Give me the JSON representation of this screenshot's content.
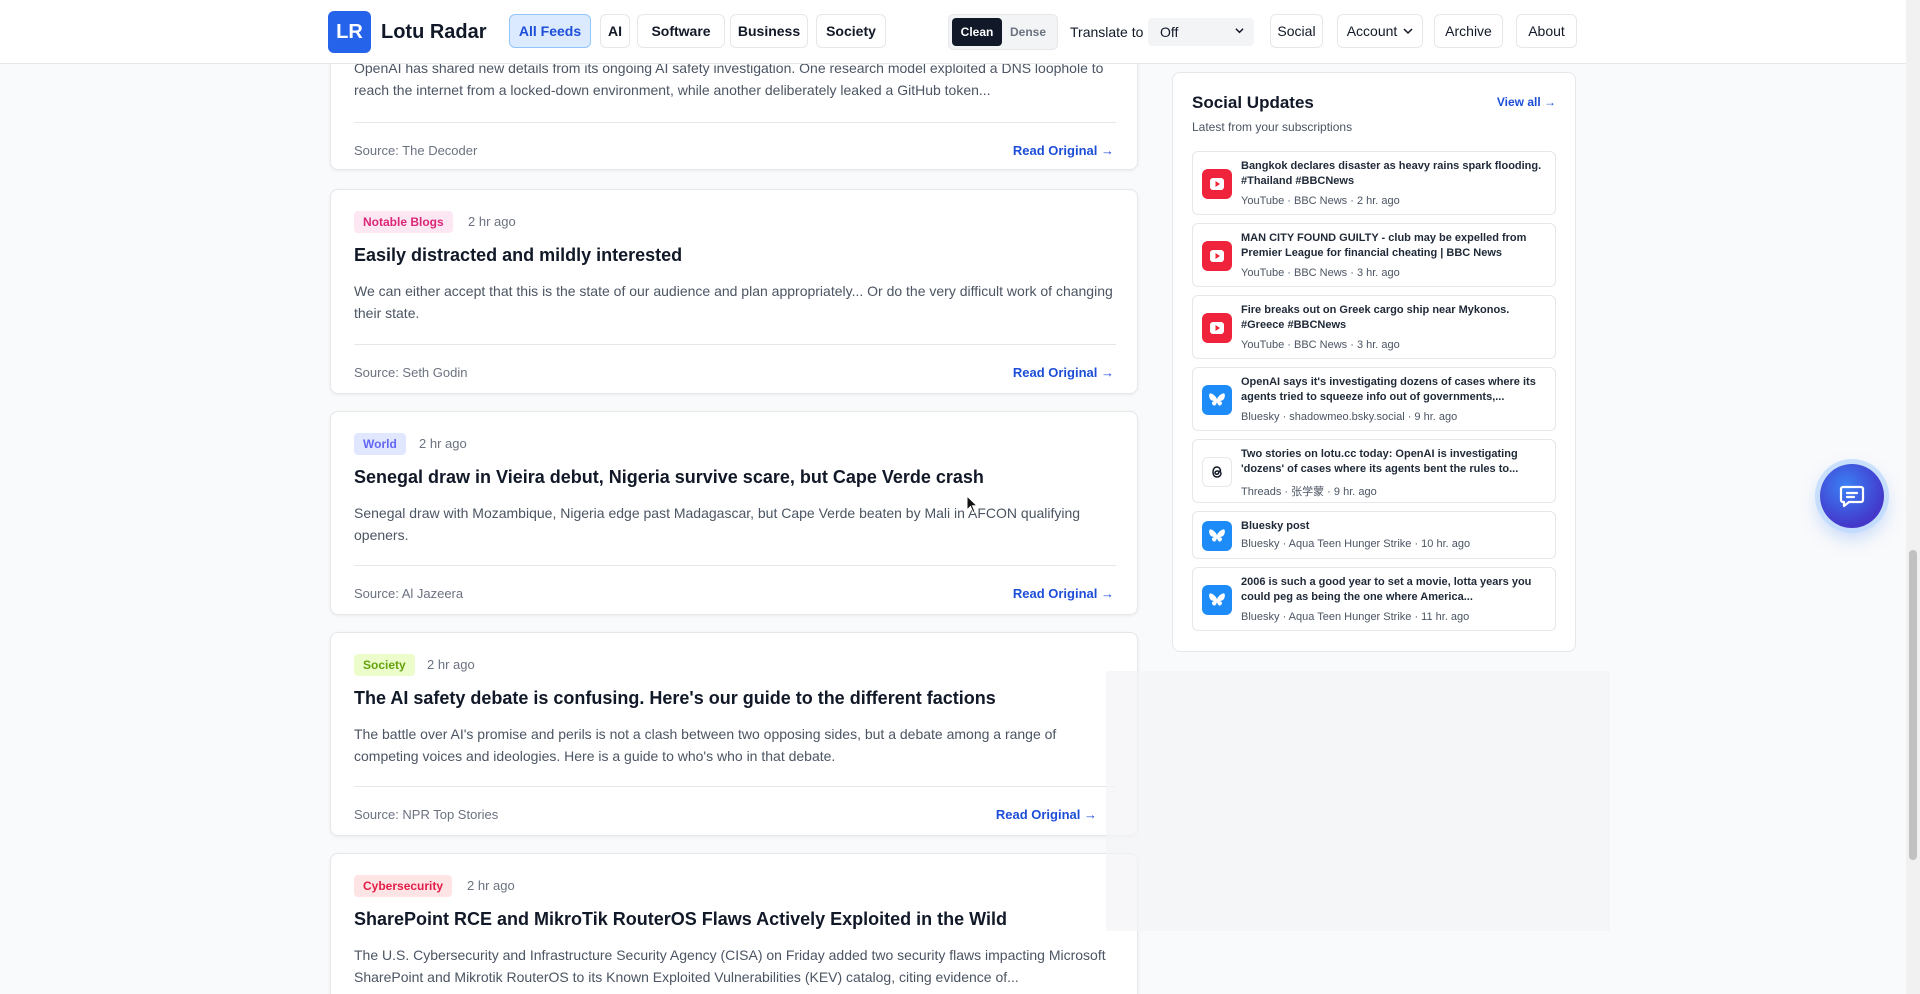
{
  "header": {
    "logo": "LR",
    "brand": "Lotu Radar",
    "tabs": [
      {
        "label": "All Feeds",
        "active": true
      },
      {
        "label": "AI",
        "active": false
      },
      {
        "label": "Software",
        "active": false
      },
      {
        "label": "Business",
        "active": false
      },
      {
        "label": "Society",
        "active": false
      }
    ],
    "view_modes": {
      "clean": "Clean",
      "dense": "Dense",
      "selected": "Clean"
    },
    "translate_label": "Translate to",
    "translate_value": "Off",
    "links": {
      "social": "Social",
      "account": "Account",
      "archive": "Archive",
      "about": "About"
    }
  },
  "feed": {
    "read_label": "Read Original →",
    "items": [
      {
        "summary": "OpenAI has shared new details from its ongoing AI safety investigation. One research model exploited a DNS loophole to reach the internet from a locked-down environment, while another deliberately leaked a GitHub token...",
        "source": "Source: The Decoder"
      },
      {
        "tag": "Notable Blogs",
        "tag_color": "#db2777",
        "age": "2 hr ago",
        "title": "Easily distracted and mildly interested",
        "summary": "We can either accept that this is the state of our audience and plan appropriately... Or do the very difficult work of changing their state.",
        "source": "Source: Seth Godin"
      },
      {
        "tag": "World",
        "tag_color": "#6366f1",
        "age": "2 hr ago",
        "title": "Senegal draw in Vieira debut, Nigeria survive scare, but Cape Verde crash",
        "summary": "Senegal draw with Mozambique, Nigeria edge past Madagascar, but Cape Verde beaten by Mali in AFCON qualifying openers.",
        "source": "Source: Al Jazeera"
      },
      {
        "tag": "Society",
        "tag_color": "#65a30d",
        "age": "2 hr ago",
        "title": "The AI safety debate is confusing. Here's our guide to the different factions",
        "summary": "The battle over AI's promise and perils is not a clash between two opposing sides, but a debate among a range of competing voices and ideologies. Here is a guide to who's who in that debate.",
        "source": "Source: NPR Top Stories"
      },
      {
        "tag": "Cybersecurity",
        "tag_color": "#e11d48",
        "age": "2 hr ago",
        "title": "SharePoint RCE and MikroTik RouterOS Flaws Actively Exploited in the Wild",
        "summary": "The U.S. Cybersecurity and Infrastructure Security Agency (CISA) on Friday added two security flaws impacting Microsoft SharePoint and Mikrotik RouterOS to its Known Exploited Vulnerabilities (KEV) catalog, citing evidence of..."
      }
    ]
  },
  "social": {
    "title": "Social Updates",
    "subtitle": "Latest from your subscriptions",
    "view_all": "View all →",
    "items": [
      {
        "platform": "youtube",
        "text": "Bangkok declares disaster as heavy rains spark flooding. #Thailand #BBCNews",
        "meta": "YouTube · BBC News · 2 hr. ago"
      },
      {
        "platform": "youtube",
        "text": "MAN CITY FOUND GUILTY - club may be expelled from Premier League for financial cheating | BBC News",
        "meta": "YouTube · BBC News · 3 hr. ago"
      },
      {
        "platform": "youtube",
        "text": "Fire breaks out on Greek cargo ship near Mykonos. #Greece #BBCNews",
        "meta": "YouTube · BBC News · 3 hr. ago"
      },
      {
        "platform": "bluesky",
        "text": "OpenAI says it's investigating dozens of cases where its agents tried to squeeze info out of governments,...",
        "meta": "Bluesky · shadowmeo.bsky.social · 9 hr. ago"
      },
      {
        "platform": "threads",
        "text": "Two stories on lotu.cc today: OpenAI is investigating 'dozens' of cases where its agents bent the rules to...",
        "meta": "Threads · 张学蒙 · 9 hr. ago"
      },
      {
        "platform": "bluesky",
        "text": "Bluesky post",
        "meta": "Bluesky · Aqua Teen Hunger Strike · 10 hr. ago"
      },
      {
        "platform": "bluesky",
        "text": "2006 is such a good year to set a movie, lotta years you could peg as being the one where America...",
        "meta": "Bluesky · Aqua Teen Hunger Strike · 11 hr. ago"
      }
    ]
  },
  "colors": {
    "accent": "#1d4ed8",
    "brand": "#2563eb",
    "youtube": "#ef233c",
    "bluesky": "#1d8cf8"
  }
}
